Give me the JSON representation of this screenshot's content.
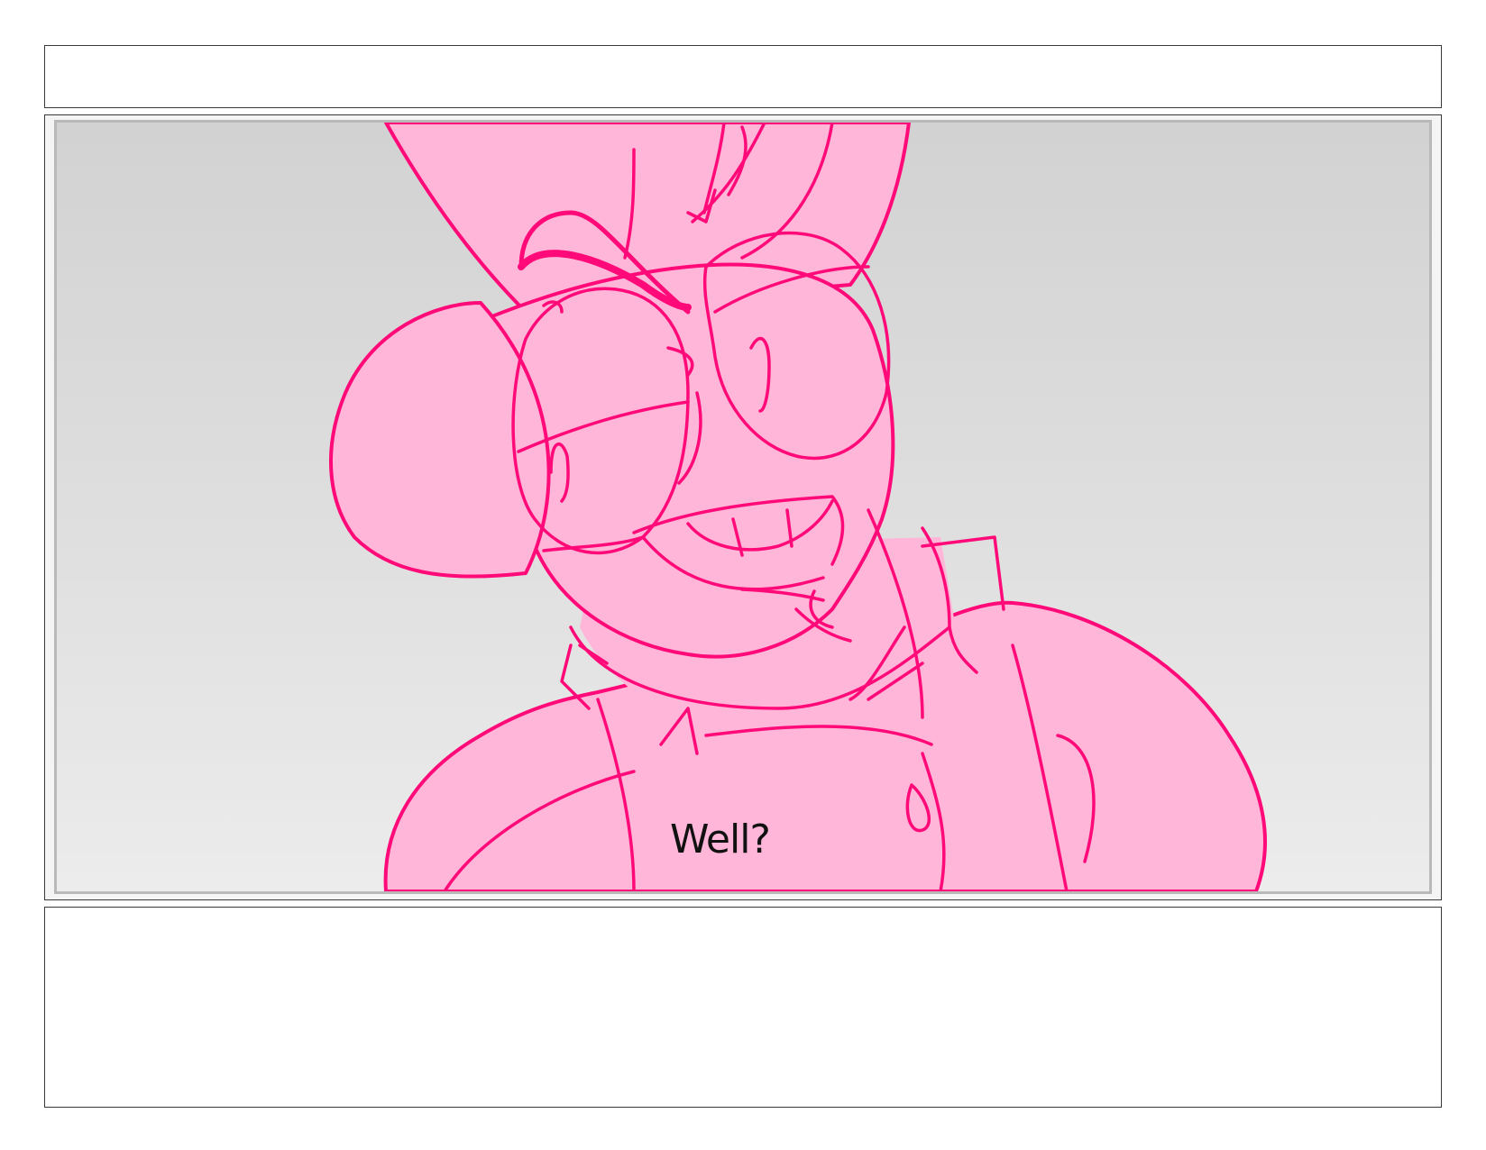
{
  "header": {
    "text": ""
  },
  "panel": {
    "dialogue": "Well?",
    "colors": {
      "fill": "#ffb6d9",
      "line": "#ff0a78",
      "background_top": "#d2d2d2",
      "background_bottom": "#ececec"
    }
  },
  "notes": {
    "text": ""
  }
}
